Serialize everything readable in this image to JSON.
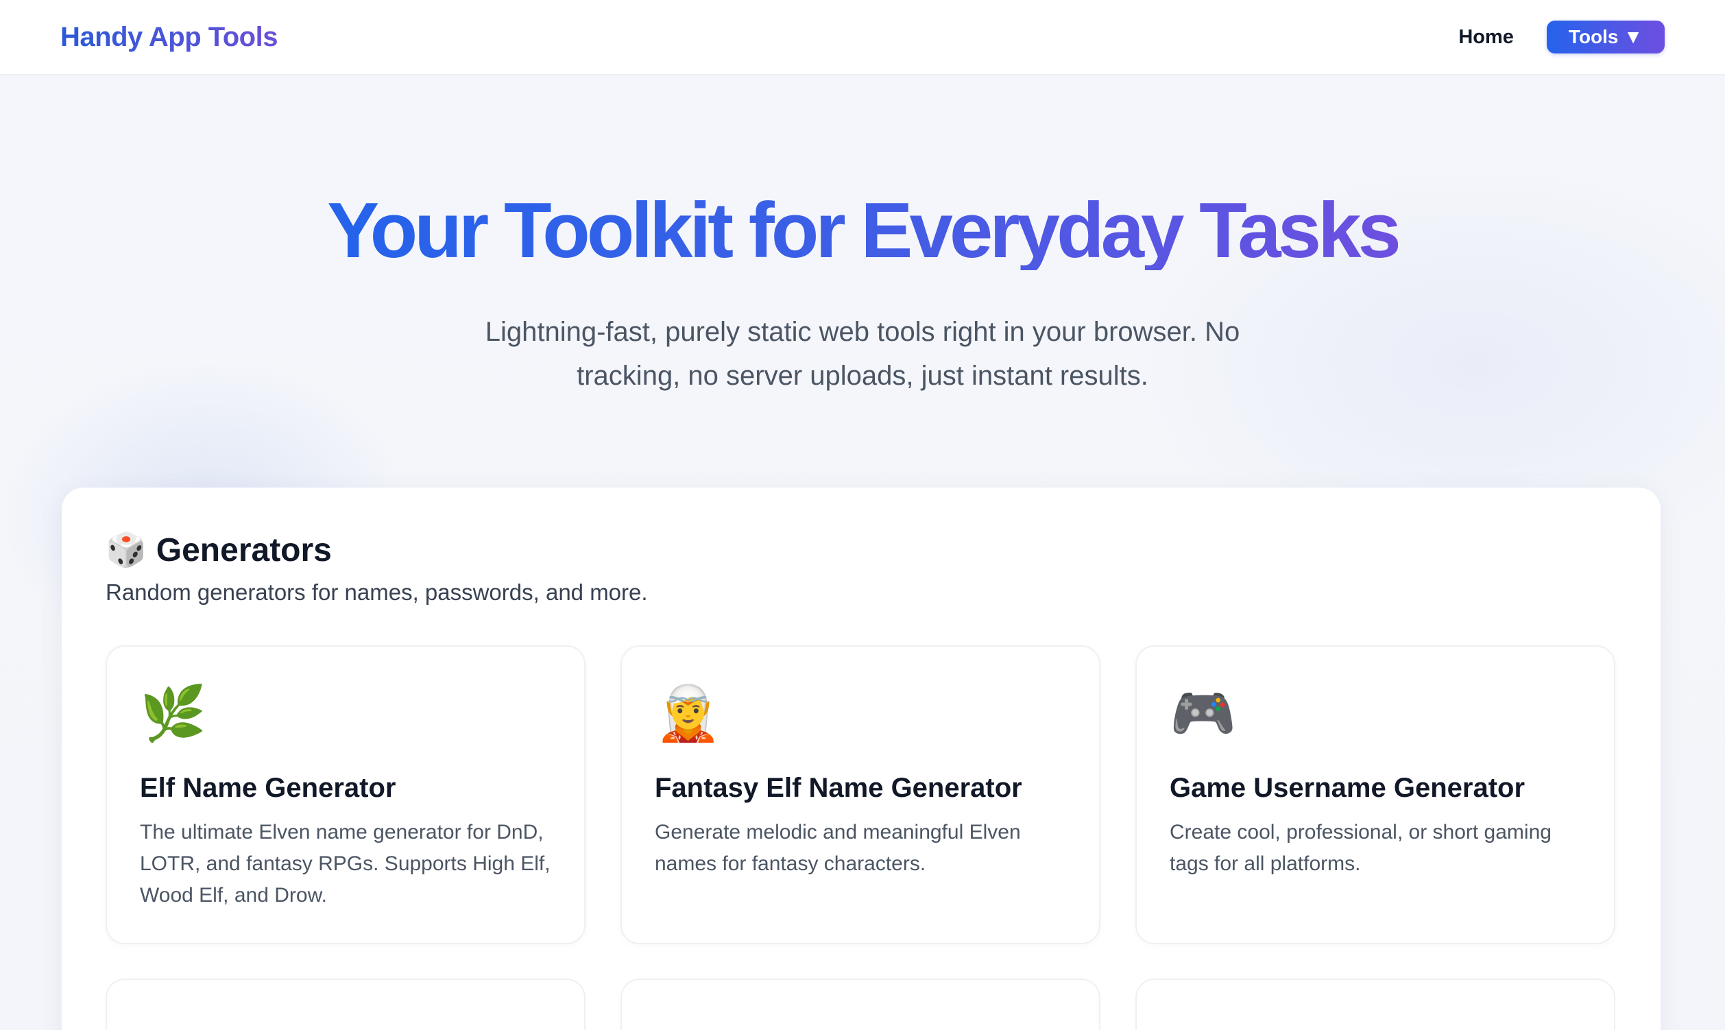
{
  "navbar": {
    "brand": "Handy App Tools",
    "home_label": "Home",
    "tools_label": "Tools ▼"
  },
  "hero": {
    "title": "Your Toolkit for Everyday Tasks",
    "subtitle": "Lightning-fast, purely static web tools right in your browser. No tracking, no server uploads, just instant results."
  },
  "section": {
    "icon": "🎲",
    "icon_name": "dice-icon",
    "title": "Generators",
    "description": "Random generators for names, passwords, and more."
  },
  "cards": [
    {
      "icon": "🌿",
      "icon_name": "leaf-icon",
      "title": "Elf Name Generator",
      "description": "The ultimate Elven name generator for DnD, LOTR, and fantasy RPGs. Supports High Elf, Wood Elf, and Drow."
    },
    {
      "icon": "🧝",
      "icon_name": "elf-icon",
      "title": "Fantasy Elf Name Generator",
      "description": "Generate melodic and meaningful Elven names for fantasy characters."
    },
    {
      "icon": "🎮",
      "icon_name": "gamepad-icon",
      "title": "Game Username Generator",
      "description": "Create cool, professional, or short gaming tags for all platforms."
    }
  ]
}
